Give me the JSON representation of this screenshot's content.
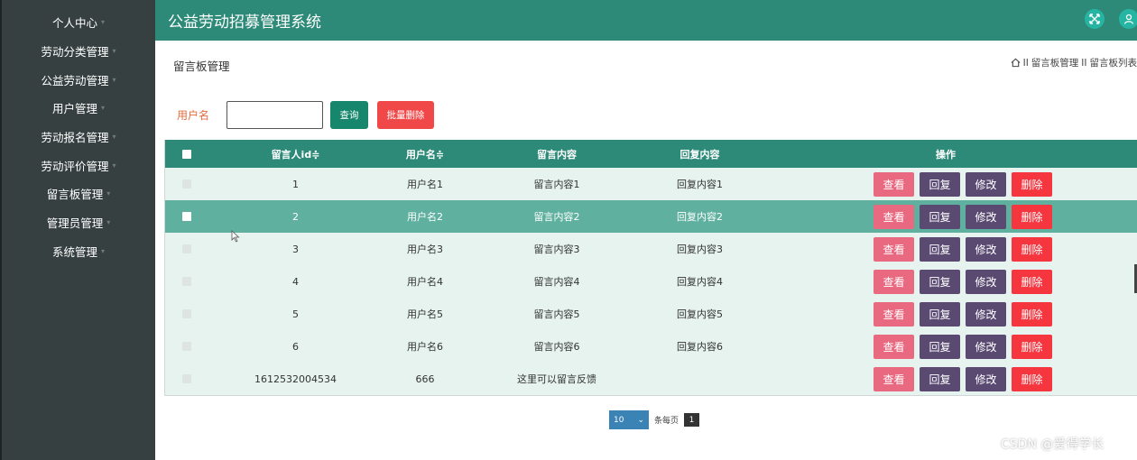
{
  "sidebar": {
    "items": [
      {
        "label": "个人中心"
      },
      {
        "label": "劳动分类管理"
      },
      {
        "label": "公益劳动管理"
      },
      {
        "label": "用户管理"
      },
      {
        "label": "劳动报名管理"
      },
      {
        "label": "劳动评价管理"
      },
      {
        "label": "留言板管理"
      },
      {
        "label": "管理员管理"
      },
      {
        "label": "系统管理"
      }
    ]
  },
  "header": {
    "title": "公益劳动招募管理系统",
    "fullscreen_icon": "expand-icon",
    "user_icon": "user-icon",
    "accent": "#2e8a78"
  },
  "page": {
    "title": "留言板管理",
    "breadcrumb": [
      "留言板管理",
      "留言板列表"
    ],
    "breadcrumb_sep": "II"
  },
  "search": {
    "label": "用户名",
    "value": "",
    "query_label": "查询",
    "batch_delete_label": "批量删除"
  },
  "table": {
    "columns": [
      "留言人id≑",
      "用户名≑",
      "留言内容",
      "回复内容",
      "操作"
    ],
    "rows": [
      {
        "id": "1",
        "user": "用户名1",
        "content": "留言内容1",
        "reply": "回复内容1"
      },
      {
        "id": "2",
        "user": "用户名2",
        "content": "留言内容2",
        "reply": "回复内容2"
      },
      {
        "id": "3",
        "user": "用户名3",
        "content": "留言内容3",
        "reply": "回复内容3"
      },
      {
        "id": "4",
        "user": "用户名4",
        "content": "留言内容4",
        "reply": "回复内容4"
      },
      {
        "id": "5",
        "user": "用户名5",
        "content": "留言内容5",
        "reply": "回复内容5"
      },
      {
        "id": "6",
        "user": "用户名6",
        "content": "留言内容6",
        "reply": "回复内容6"
      },
      {
        "id": "1612532004534",
        "user": "666",
        "content": "这里可以留言反馈",
        "reply": ""
      }
    ],
    "highlighted_row": 1,
    "actions": {
      "view": "查看",
      "reply": "回复",
      "edit": "修改",
      "delete": "删除"
    }
  },
  "pagination": {
    "page_size": "10",
    "per_page_label": "条每页",
    "current_page": "1"
  },
  "watermark": "CSDN @爱得学长"
}
